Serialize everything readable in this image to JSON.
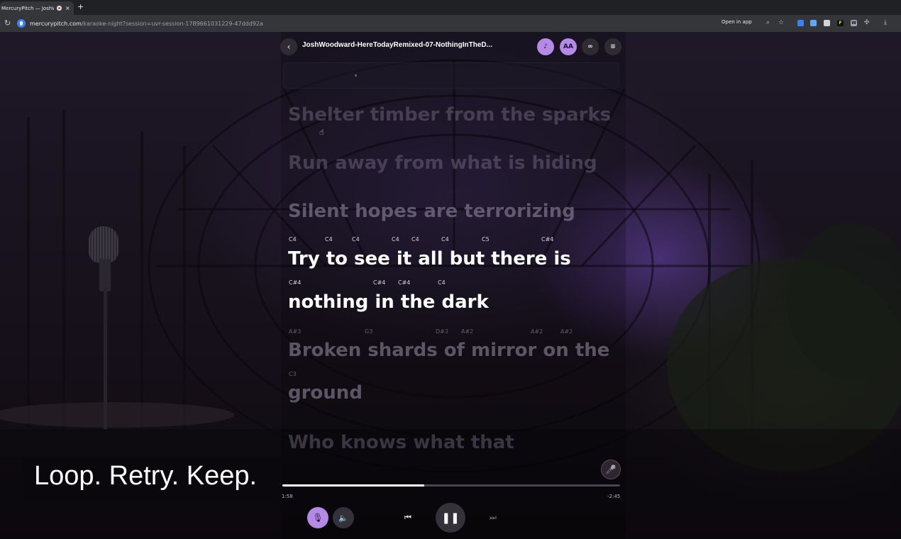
{
  "browser": {
    "tab_title": "MercuryPitch — JoshWoo",
    "tab_close": "×",
    "new_tab": "+",
    "url_host": "mercurypitch.com",
    "url_path": "/karaoke-night?session=uvr-session-1789661031229-47ddd92a",
    "open_in_app": "Open in app",
    "icons": [
      "reload-icon",
      "zoom-icon",
      "star-icon",
      "extension-icons",
      "download-icon"
    ]
  },
  "header": {
    "back_icon": "‹",
    "title": "JoshWoodward-HereTodayRemixed-07-NothingInTheD...",
    "buttons": [
      {
        "name": "pitch-guide-button",
        "glyph": "♪",
        "style": "purple"
      },
      {
        "name": "font-size-button",
        "glyph": "AA",
        "style": "purple"
      },
      {
        "name": "loop-button",
        "glyph": "∞",
        "style": "dark"
      },
      {
        "name": "queue-button",
        "glyph": "≡",
        "style": "dark"
      }
    ]
  },
  "lyrics": [
    {
      "text": "Shelter timber from the sparks",
      "state": "past"
    },
    {
      "text": "Run away from what is hiding",
      "state": "past"
    },
    {
      "text": "Silent hopes are terrorizing",
      "state": "past"
    },
    {
      "text": "Try to see it all but there is",
      "state": "active",
      "notes": [
        "C4",
        "C4",
        "C4",
        "C4",
        "C4",
        "C4",
        "C5",
        "C#4"
      ]
    },
    {
      "text": "nothing in the dark",
      "state": "active",
      "notes": [
        "C#4",
        "C#4",
        "C#4",
        "C4"
      ]
    },
    {
      "text": "Broken shards of mirror on the",
      "state": "upcoming",
      "notes": [
        "A#3",
        "G3",
        "D#3",
        "A#2",
        "A#2",
        "A#2"
      ]
    },
    {
      "text": "ground",
      "state": "upcoming",
      "notes": [
        "C3"
      ]
    },
    {
      "text": "Who knows what that",
      "state": "upcoming"
    }
  ],
  "caption": "Loop. Retry. Keep.",
  "player": {
    "elapsed": "1:58",
    "remaining": "-2:45",
    "progress": 0.42,
    "sing_icon": "🎤",
    "mic_icon": "🎙",
    "volume_icon": "🔈",
    "prev_icon": "⏮",
    "play_pause_icon": "❚❚",
    "next_icon": "⏭"
  },
  "colors": {
    "accent": "#b48ae6",
    "background": "#19131f",
    "active_lyric": "#ffffff"
  }
}
